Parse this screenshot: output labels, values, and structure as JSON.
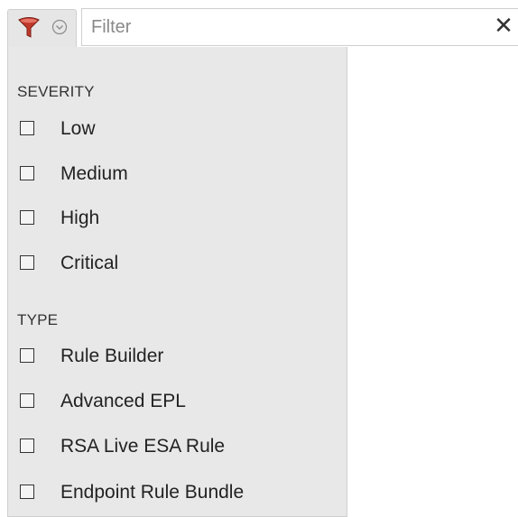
{
  "toolbar": {
    "filter_icon": "funnel-icon",
    "filter_icon_color": "#c0392b",
    "dropdown_icon": "chevron-down-circle-icon",
    "search_placeholder": "Filter",
    "search_value": "",
    "clear_label": "✕"
  },
  "filter_panel": {
    "sections": [
      {
        "title": "SEVERITY",
        "options": [
          {
            "label": "Low",
            "checked": false
          },
          {
            "label": "Medium",
            "checked": false
          },
          {
            "label": "High",
            "checked": false
          },
          {
            "label": "Critical",
            "checked": false
          }
        ]
      },
      {
        "title": "TYPE",
        "options": [
          {
            "label": "Rule Builder",
            "checked": false
          },
          {
            "label": "Advanced EPL",
            "checked": false
          },
          {
            "label": "RSA Live ESA Rule",
            "checked": false
          },
          {
            "label": "Endpoint Rule Bundle",
            "checked": false
          }
        ]
      }
    ]
  }
}
